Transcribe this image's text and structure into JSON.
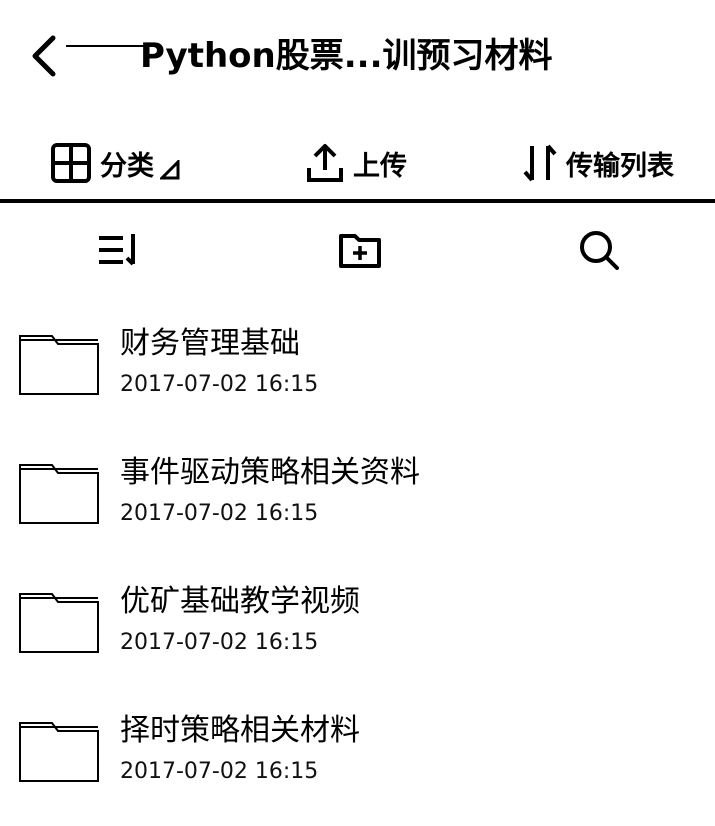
{
  "header": {
    "title": "Python股票...训预习材料"
  },
  "nav": {
    "items": [
      {
        "label": "分类",
        "icon": "grid-icon"
      },
      {
        "label": "上传",
        "icon": "upload-icon"
      },
      {
        "label": "传输列表",
        "icon": "transfer-icon"
      }
    ]
  },
  "toolbar": {
    "icons": [
      "sort-icon",
      "new-folder-icon",
      "search-icon"
    ]
  },
  "files": [
    {
      "name": "财务管理基础",
      "date": "2017-07-02  16:15"
    },
    {
      "name": "事件驱动策略相关资料",
      "date": "2017-07-02  16:15"
    },
    {
      "name": "优矿基础教学视频",
      "date": "2017-07-02  16:15"
    },
    {
      "name": "择时策略相关材料",
      "date": "2017-07-02  16:15"
    }
  ]
}
